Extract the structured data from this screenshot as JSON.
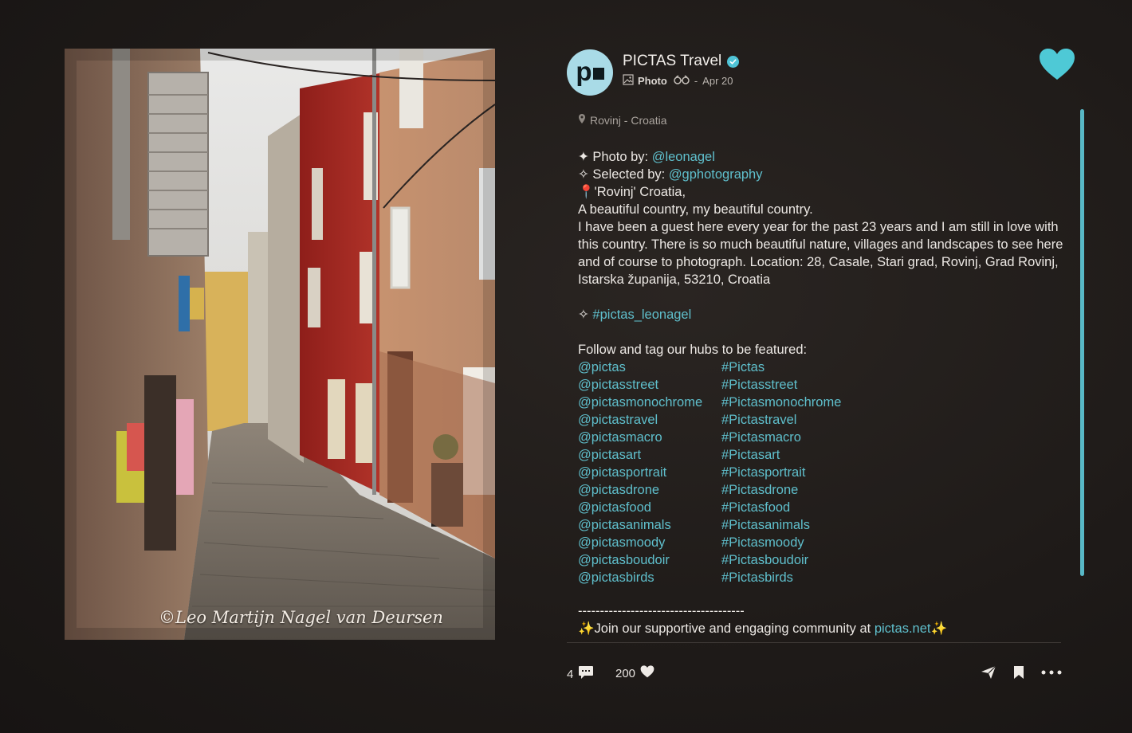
{
  "post": {
    "photo": {
      "watermark": "©Leo Martijn Nagel van Deursen"
    },
    "account": {
      "avatar_text": "p",
      "name": "PICTAS Travel",
      "verified": true,
      "post_type": "Photo",
      "date": "Apr 20"
    },
    "location": "Rovinj - Croatia",
    "caption": {
      "photo_by_label": "✦ Photo by: ",
      "photo_by_user": "@leonagel",
      "selected_by_label": "✧ Selected by: ",
      "selected_by_user": "@gphotography",
      "place_line": "📍'Rovinj'  Croatia,",
      "line1": "A beautiful country, my beautiful country.",
      "paragraph": "I have been a guest here every year for the past 23 years and I am still in love with this country. There is so much beautiful nature, villages and landscapes to see here and of course to photograph. Location: 28, Casale, Stari grad, Rovinj, Grad Rovinj, Istarska županija, 53210, Croatia",
      "tag_prefix": "✧ ",
      "tag": "#pictas_leonagel",
      "follow_line": "Follow and tag our hubs to be featured:",
      "hubs": [
        [
          "@pictas",
          "#Pictas"
        ],
        [
          "@pictasstreet",
          "#Pictasstreet"
        ],
        [
          "@pictasmonochrome",
          "#Pictasmonochrome"
        ],
        [
          "@pictastravel",
          "#Pictastravel"
        ],
        [
          "@pictasmacro",
          "#Pictasmacro"
        ],
        [
          "@pictasart",
          "#Pictasart"
        ],
        [
          "@pictasportrait",
          "#Pictasportrait"
        ],
        [
          "@pictasdrone",
          "#Pictasdrone"
        ],
        [
          "@pictasfood",
          "#Pictasfood"
        ],
        [
          "@pictasanimals",
          "#Pictasanimals"
        ],
        [
          "@pictasmoody",
          "#Pictasmoody"
        ],
        [
          "@pictasboudoir",
          "#Pictasboudoir"
        ],
        [
          "@pictasbirds",
          "#Pictasbirds"
        ]
      ],
      "dashes": "--------------------------------------",
      "join_prefix": "✨Join our supportive and engaging community at ",
      "join_link": "pictas.net",
      "join_suffix": "✨"
    },
    "footer": {
      "comments_count": "4",
      "likes_count": "200"
    },
    "colors": {
      "accent": "#5fbfcc",
      "heart": "#4ec9d6",
      "background": "#1e1a18"
    },
    "icons": [
      "verified-icon",
      "photo-type-icon",
      "binoculars-icon",
      "location-pin-icon",
      "heart-icon",
      "comment-icon",
      "like-heart-icon",
      "share-icon",
      "bookmark-icon",
      "more-icon"
    ]
  }
}
